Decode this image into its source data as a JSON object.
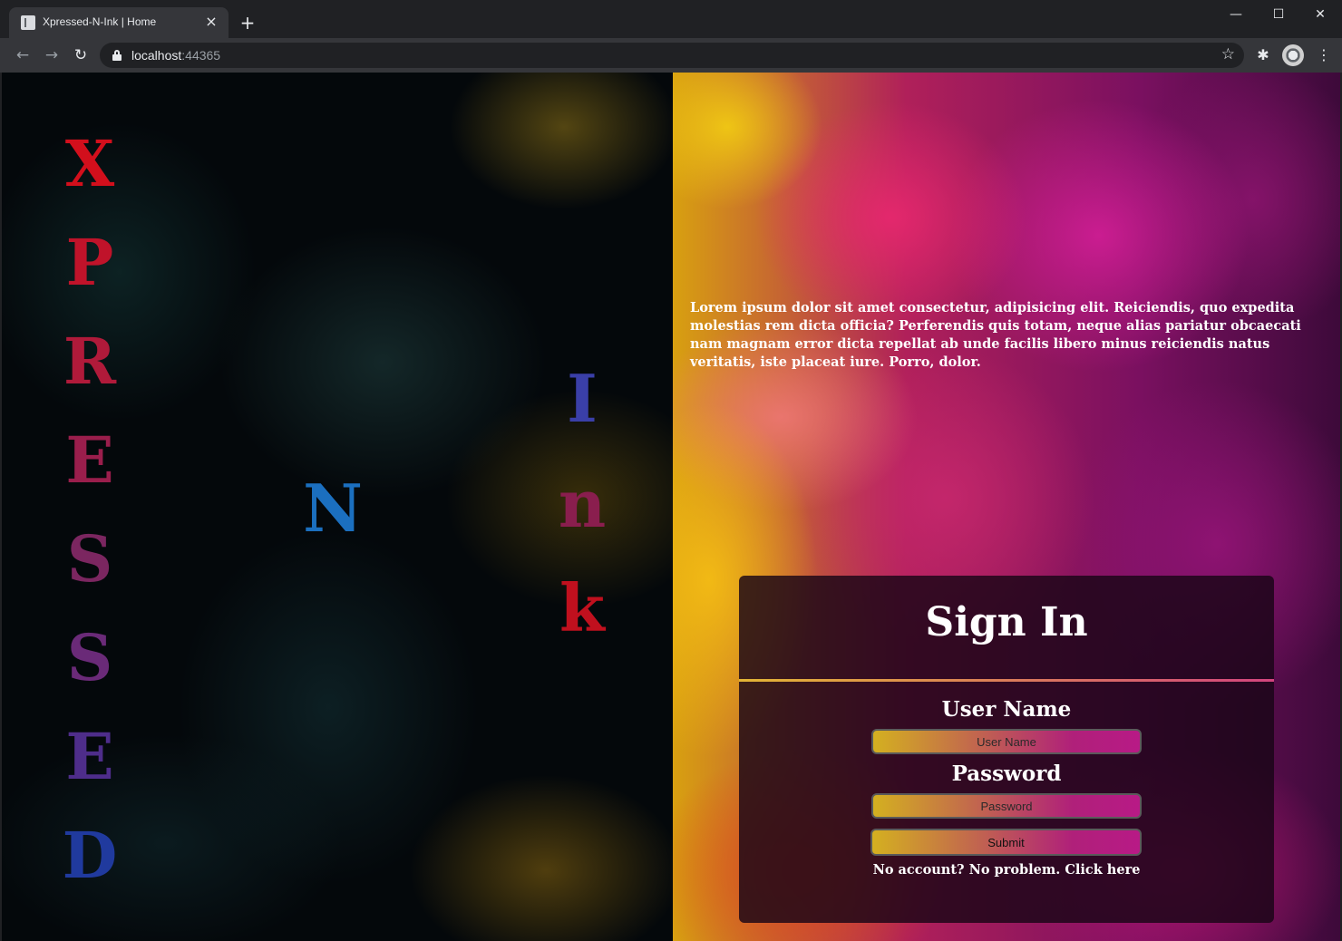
{
  "browser": {
    "tab_title": "Xpressed-N-Ink | Home",
    "tab_close": "×",
    "new_tab": "+",
    "url_host": "localhost",
    "url_port": ":44365",
    "window_controls": {
      "minimize": "—",
      "maximize": "☐",
      "close": "✕"
    },
    "icons": {
      "back": "←",
      "forward": "→",
      "reload": "↻",
      "star": "☆",
      "extensions": "✱",
      "menu": "⋮"
    }
  },
  "logo": {
    "xpressed_letters": [
      "X",
      "P",
      "R",
      "E",
      "S",
      "S",
      "E",
      "D"
    ],
    "xpressed_colors": [
      "#d20f1c",
      "#c0132a",
      "#b01a3a",
      "#9a1e4c",
      "#7b2660",
      "#6a2a78",
      "#4e2d8a",
      "#203a9e"
    ],
    "n_letter": "N",
    "n_color": "#1b6fbf",
    "ink_letters": [
      "I",
      "n",
      "k"
    ],
    "ink_colors": [
      "#3a3fa8",
      "#8a1e4e",
      "#c0101e"
    ]
  },
  "intro": {
    "text": "Lorem ipsum dolor sit amet consectetur, adipisicing elit. Reiciendis, quo expedita molestias rem dicta officia? Perferendis quis totam, neque alias pariatur obcaecati nam magnam error dicta repellat ab unde facilis libero minus reiciendis natus veritatis, iste placeat iure. Porro, dolor."
  },
  "signin": {
    "title": "Sign In",
    "username_label": "User Name",
    "username_placeholder": "User Name",
    "username_value": "",
    "password_label": "Password",
    "password_placeholder": "Password",
    "password_value": "",
    "submit_label": "Submit",
    "signup_text": "No account? No problem. Click here"
  }
}
